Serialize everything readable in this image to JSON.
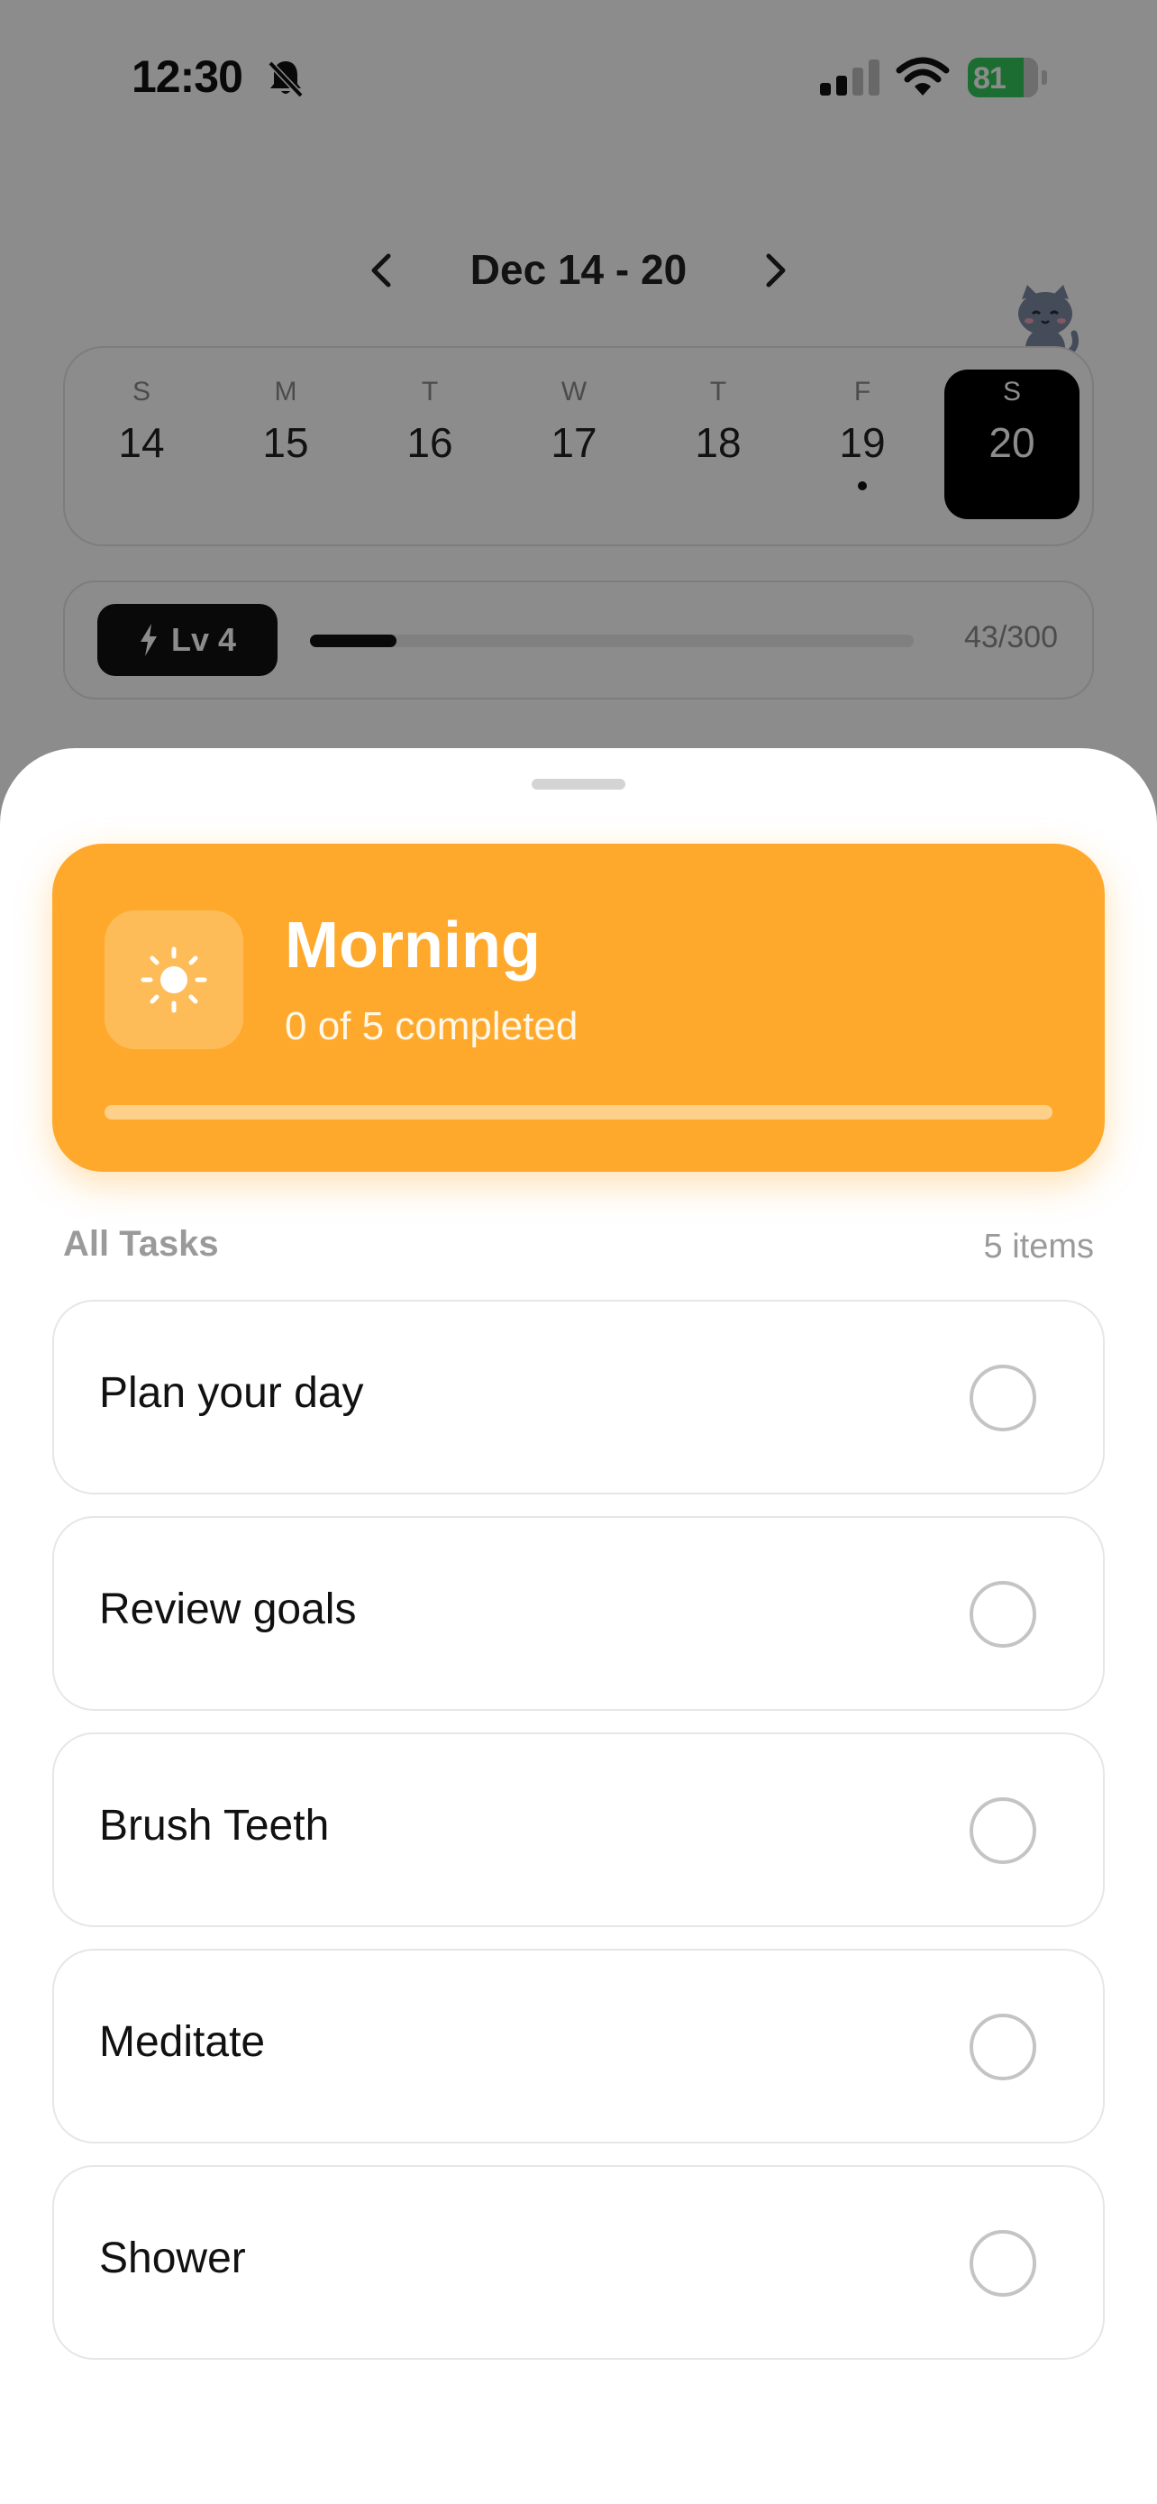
{
  "status_bar": {
    "time": "12:30",
    "battery": "81"
  },
  "week_nav": {
    "range": "Dec 14 - 20"
  },
  "days": [
    {
      "dow": "S",
      "num": "14",
      "has_dot": false,
      "selected": false
    },
    {
      "dow": "M",
      "num": "15",
      "has_dot": false,
      "selected": false
    },
    {
      "dow": "T",
      "num": "16",
      "has_dot": false,
      "selected": false
    },
    {
      "dow": "W",
      "num": "17",
      "has_dot": false,
      "selected": false
    },
    {
      "dow": "T",
      "num": "18",
      "has_dot": false,
      "selected": false
    },
    {
      "dow": "F",
      "num": "19",
      "has_dot": true,
      "selected": false
    },
    {
      "dow": "S",
      "num": "20",
      "has_dot": false,
      "selected": true
    }
  ],
  "level": {
    "label": "Lv 4",
    "xp_text": "43/300",
    "xp_fraction": 0.143
  },
  "routine": {
    "title": "Morning",
    "progress_text": "0 of 5 completed",
    "progress_fraction": 0,
    "color": "#fea92b"
  },
  "tasks_header": {
    "title": "All Tasks",
    "count": "5 items"
  },
  "tasks": [
    {
      "label": "Plan your day",
      "done": false
    },
    {
      "label": "Review goals",
      "done": false
    },
    {
      "label": "Brush Teeth",
      "done": false
    },
    {
      "label": "Meditate",
      "done": false
    },
    {
      "label": "Shower",
      "done": false
    }
  ],
  "icons": {
    "bell": "bell-slash-icon",
    "signal": "cellular-signal-icon",
    "wifi": "wifi-icon",
    "battery": "battery-charging-icon",
    "prev": "chevron-left-icon",
    "next": "chevron-right-icon",
    "mascot": "cat-mascot-icon",
    "level": "lightning-bolt-icon",
    "routine": "sun-icon"
  }
}
